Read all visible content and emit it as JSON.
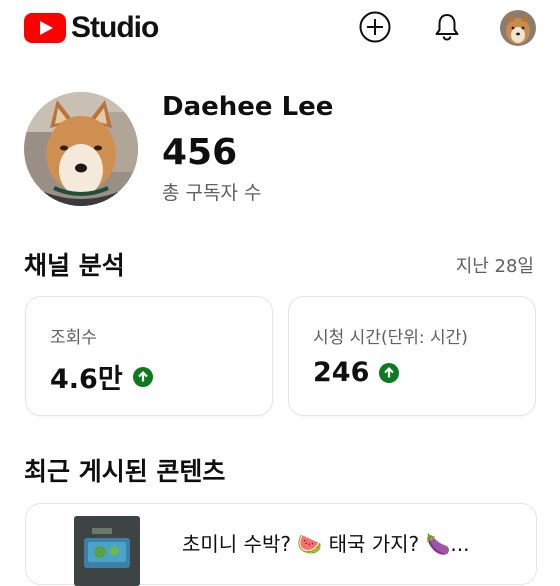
{
  "app": {
    "logo_text": "Studio",
    "brand_color": "#ff0000"
  },
  "header": {
    "icons": [
      "create-icon",
      "notifications-bell-icon",
      "account-avatar"
    ]
  },
  "profile": {
    "name": "Daehee Lee",
    "subscriber_count": "456",
    "subscriber_label": "총 구독자 수"
  },
  "analytics": {
    "title": "채널 분석",
    "period": "지난 28일",
    "cards": [
      {
        "label": "조회수",
        "value": "4.6만",
        "trend": "up",
        "trend_color": "#0e7a1f"
      },
      {
        "label": "시청 시간(단위: 시간)",
        "value": "246",
        "trend": "up",
        "trend_color": "#0e7a1f"
      }
    ]
  },
  "recent": {
    "title": "최근 게시된 콘텐츠",
    "items": [
      {
        "title": "초미니 수박? 🍉 태국 가지? 🍆..."
      }
    ]
  }
}
